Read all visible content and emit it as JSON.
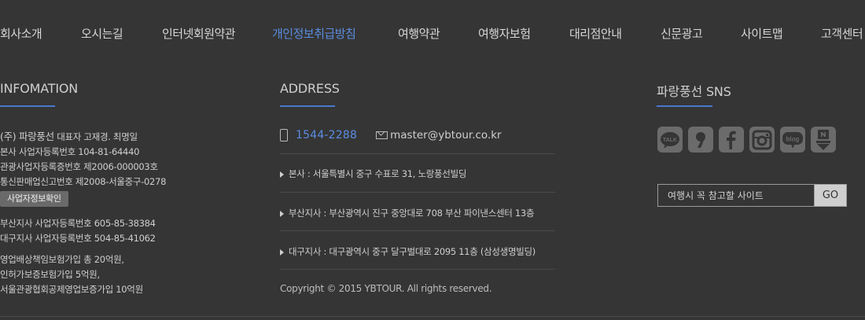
{
  "nav": [
    {
      "label": "회사소개"
    },
    {
      "label": "오시는길"
    },
    {
      "label": "인터넷회원약관"
    },
    {
      "label": "개인정보취급방침",
      "active": true
    },
    {
      "label": "여행약관"
    },
    {
      "label": "여행자보험"
    },
    {
      "label": "대리점안내"
    },
    {
      "label": "신문광고"
    },
    {
      "label": "사이트맵"
    },
    {
      "label": "고객센터"
    }
  ],
  "info": {
    "title": "INFOMATION",
    "company": "(주) 파랑풍선",
    "ceo": "대표자 고재경. 최명일",
    "lines1": [
      "본사 사업자등록번호 104-81-64440",
      "관광사업자등록증번호 제2006-000003호",
      "통신판매업신고번호 제2008-서울중구-0278"
    ],
    "biz_button": "사업자정보확인",
    "lines2": [
      "부산지사 사업자등록번호 605-85-38384",
      "대구지사 사업자등록번호 504-85-41062"
    ],
    "lines3": [
      "영업배상책임보험가입 총 20억원,",
      "인허가보증보험가입 5억원,",
      "서울관광협회공제영업보증가입 10억원"
    ]
  },
  "address": {
    "title": "ADDRESS",
    "phone": "1544-2288",
    "email": "master@ybtour.co.kr",
    "branches": [
      "본사 : 서울특별시 중구 수표로 31, 노랑풍선빌딩",
      "부산지사 : 부산광역시 진구 중앙대로 708 부산 파이낸스센터 13층",
      "대구지사 : 대구광역시 중구 달구벌대로 2095 11층 (삼성생명빌딩)"
    ],
    "copyright": "Copyright © 2015 YBTOUR. All rights reserved."
  },
  "sns": {
    "title": "파랑풍선 SNS",
    "icons": [
      "kakaotalk-icon",
      "kakaostory-icon",
      "facebook-icon",
      "instagram-icon",
      "blog-icon",
      "naver-post-icon"
    ],
    "talk_text": "TALK",
    "blog_text": "blog"
  },
  "search": {
    "placeholder": "여행시 꼭 참고할 사이트",
    "go_label": "GO"
  },
  "colors": {
    "accent": "#4a78d0",
    "link": "#5a8de0",
    "background": "#353535"
  }
}
